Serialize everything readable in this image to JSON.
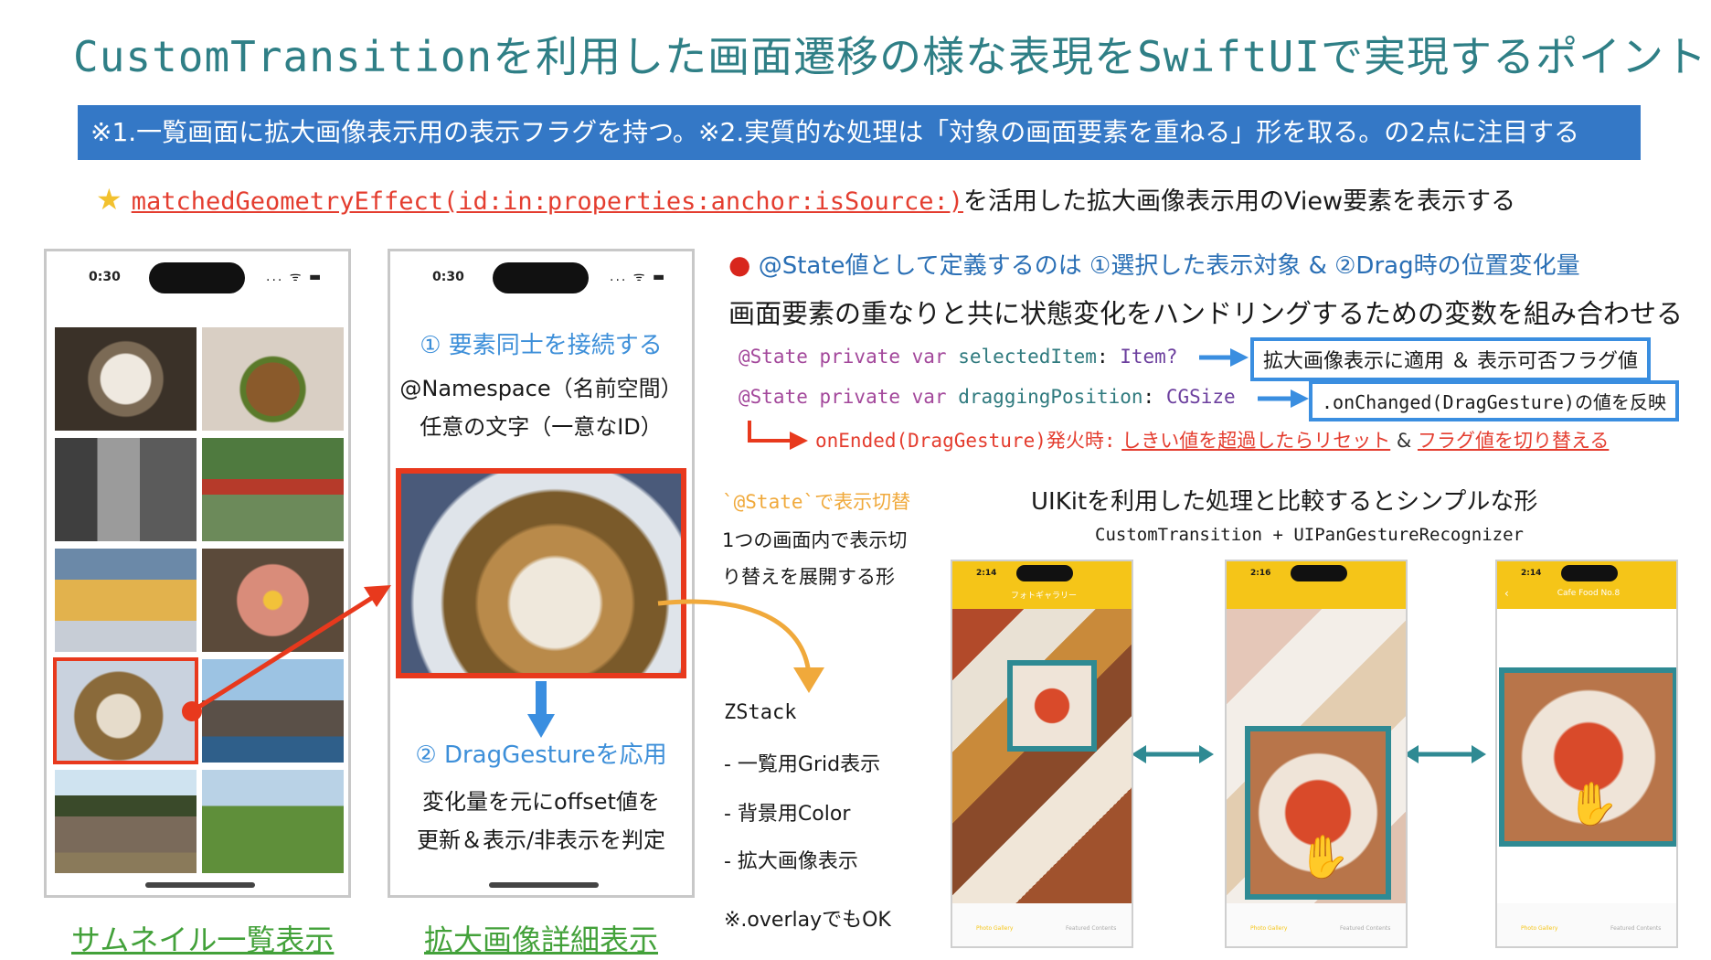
{
  "title": "CustomTransitionを利用した画面遷移の様な表現をSwiftUIで実現するポイント",
  "banner": "※1.一覧画面に拡大画像表示用の表示フラグを持つ。※2.実質的な処理は「対象の画面要素を重ねる」形を取る。の2点に注目する",
  "star_line": {
    "icon": "star-icon",
    "code": "matchedGeometryEffect(id:in:properties:anchor:isSource:)",
    "rest": "を活用した拡大画像表示用のView要素を表示する"
  },
  "phone_left": {
    "time": "0:30",
    "status": "... ᯤ ▬",
    "caption": "サムネイル一覧表示"
  },
  "phone_mid": {
    "time": "0:30",
    "status": "... ᯤ ▬",
    "step1_title": "① 要素同士を接続する",
    "step1_line1": "@Namespace（名前空間）",
    "step1_line2": "任意の文字（一意なID）",
    "step2_title": "② DragGestureを応用",
    "step2_line1": "変化量を元にoffset値を",
    "step2_line2": "更新＆表示/非表示を判定",
    "caption": "拡大画像詳細表示"
  },
  "toggle_note": {
    "title": "`@State`で表示切替",
    "line1": "1つの画面内で表示切",
    "line2": "り替えを展開する形"
  },
  "zstack": {
    "title": "ZStack",
    "item1": "- 一覧用Grid表示",
    "item2": "- 背景用Color",
    "item3": "- 拡大画像表示",
    "note": "※.overlayでもOK"
  },
  "state_section": {
    "icon": "apple-icon",
    "head1": "@State値として定義するのは ①選択した表示対象 & ②Drag時の位置変化量",
    "head2": "画面要素の重なりと共に状態変化をハンドリングするための変数を組み合わせる",
    "code1": {
      "kw": "@State private var",
      "name": "selectedItem",
      "type": "Item?"
    },
    "code2": {
      "kw": "@State private var",
      "name": "draggingPosition",
      "type": "CGSize"
    },
    "box1": "拡大画像表示に適用 ＆ 表示可否フラグ値",
    "box2": ".onChanged(DragGesture)の値を反映",
    "ended_label": "onEnded(DragGesture)発火時:",
    "ended_reset": "しきい値を超過したらリセット",
    "ended_amp": "&",
    "ended_flag": "フラグ値を切り替える"
  },
  "uikit": {
    "title": "UIKitを利用した処理と比較するとシンプルな形",
    "subtitle": "CustomTransition + UIPanGestureRecognizer",
    "screens": [
      {
        "time": "2:14",
        "nav": "フォトギャラリー"
      },
      {
        "time": "2:16",
        "nav": ""
      },
      {
        "time": "2:14",
        "nav": "Cafe Food No.8"
      }
    ],
    "tab1": "Photo Gallery",
    "tab2": "Featured Contents"
  },
  "colors": {
    "title": "#2f7f86",
    "banner": "#3478c6",
    "accent_red": "#e8391d",
    "accent_blue": "#3a8ee0",
    "accent_green": "#43a13a",
    "accent_orange": "#f0a93b",
    "teal": "#2f8a93",
    "ios_yellow": "#f5c518"
  }
}
